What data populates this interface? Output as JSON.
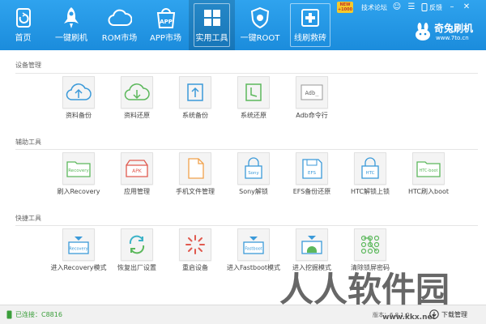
{
  "nav": [
    {
      "id": "home",
      "label": "首页",
      "icon": "home-icon"
    },
    {
      "id": "flash",
      "label": "一键刷机",
      "icon": "rocket-icon"
    },
    {
      "id": "rom",
      "label": "ROM市场",
      "icon": "cloud-icon"
    },
    {
      "id": "app",
      "label": "APP市场",
      "icon": "app-bag-icon"
    },
    {
      "id": "tools",
      "label": "实用工具",
      "icon": "grid-icon",
      "active": true
    },
    {
      "id": "root",
      "label": "一键ROOT",
      "icon": "shield-icon"
    },
    {
      "id": "rescue",
      "label": "线刷救砖",
      "icon": "first-aid-icon"
    }
  ],
  "new_badge": {
    "line1": "NEW",
    "line2": "+1000"
  },
  "top_links": {
    "forum": "技术论坛",
    "feedback": "反馈"
  },
  "brand": {
    "name": "奇兔刷机",
    "url": "www.7to.cn"
  },
  "sections": [
    {
      "title": "设备管理",
      "items": [
        {
          "label": "资料备份",
          "icon": "cloud-upload-icon"
        },
        {
          "label": "资料还原",
          "icon": "cloud-download-icon"
        },
        {
          "label": "系统备份",
          "icon": "system-backup-icon"
        },
        {
          "label": "系统还原",
          "icon": "system-restore-icon"
        },
        {
          "label": "Adb命令行",
          "icon": "adb-terminal-icon",
          "icon_text": "Adb_"
        }
      ]
    },
    {
      "title": "辅助工具",
      "items": [
        {
          "label": "刷入Recovery",
          "icon": "recovery-folder-icon",
          "icon_text": "Recovery"
        },
        {
          "label": "应用管理",
          "icon": "apk-tray-icon",
          "icon_text": "APK"
        },
        {
          "label": "手机文件管理",
          "icon": "file-icon"
        },
        {
          "label": "Sony解锁",
          "icon": "sony-lock-icon",
          "icon_text": "Sony"
        },
        {
          "label": "EFS备份还原",
          "icon": "efs-disk-icon",
          "icon_text": "EFS"
        },
        {
          "label": "HTC解锁上锁",
          "icon": "htc-lock-icon",
          "icon_text": "HTC"
        },
        {
          "label": "HTC刷入boot",
          "icon": "htc-boot-folder-icon",
          "icon_text": "HTC-boot"
        }
      ]
    },
    {
      "title": "快捷工具",
      "items": [
        {
          "label": "进入Recovery模式",
          "icon": "recovery-mode-icon",
          "icon_text": "Recovery"
        },
        {
          "label": "恢复出厂设置",
          "icon": "factory-reset-icon"
        },
        {
          "label": "重启设备",
          "icon": "reboot-icon"
        },
        {
          "label": "进入Fastboot模式",
          "icon": "fastboot-mode-icon",
          "icon_text": "Fastboot"
        },
        {
          "label": "进入挖掘模式",
          "icon": "download-mode-icon"
        },
        {
          "label": "清除锁屏密码",
          "icon": "pattern-lock-icon"
        }
      ]
    }
  ],
  "status": {
    "connection": "已连接：C8816",
    "version": "版本：6.8.1.0",
    "download": "下载管理"
  },
  "watermark": {
    "text": "人人软件园",
    "url": "www.kkx.net"
  },
  "colors": {
    "accent": "#1b8cdc",
    "icon_green": "#5cb85c",
    "icon_blue": "#3b9ad9",
    "icon_red": "#e05a4f",
    "icon_orange": "#f0a14b",
    "status_green": "#3a9e3a"
  }
}
